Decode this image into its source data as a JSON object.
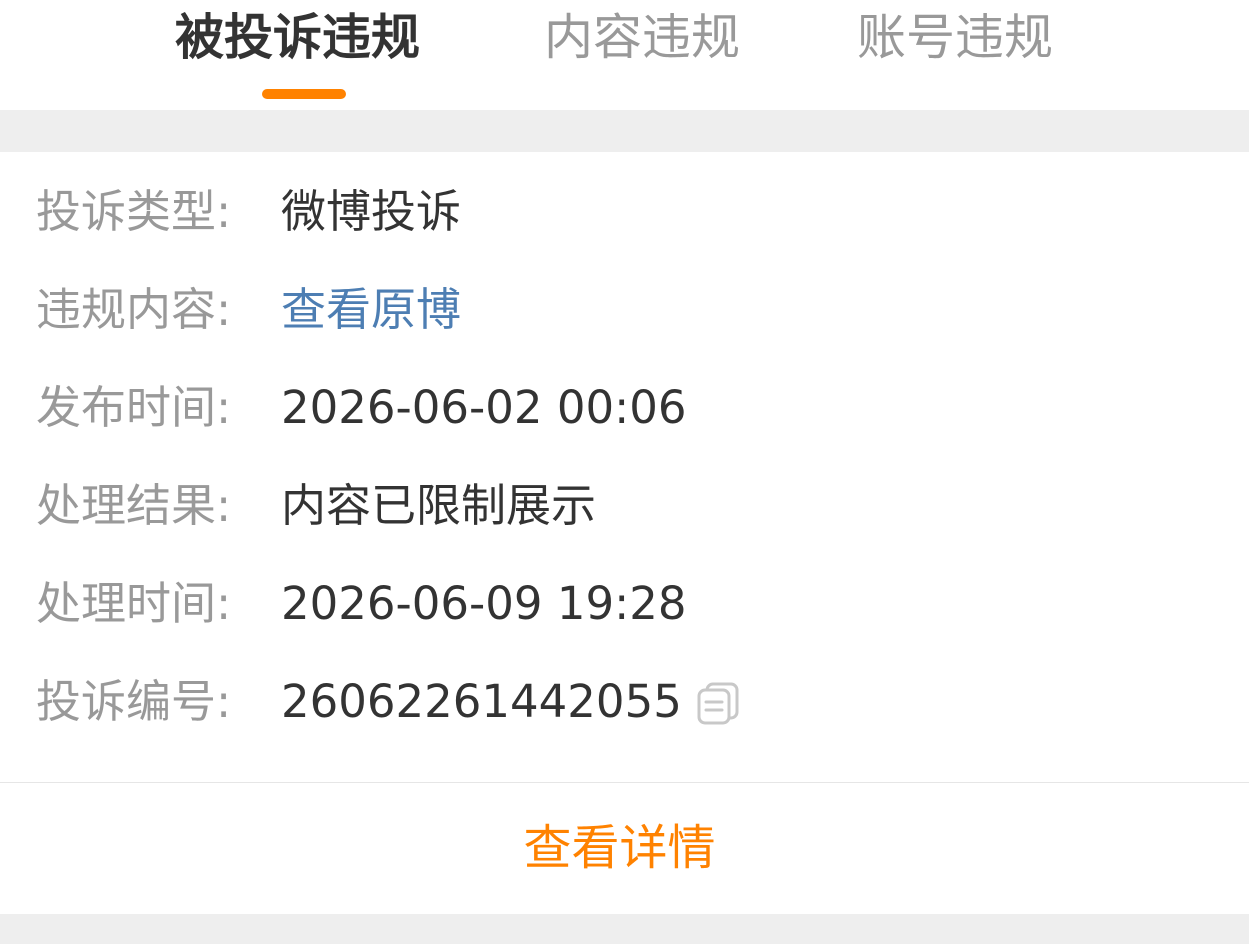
{
  "tabs": [
    {
      "label": "被投诉违规",
      "active": true
    },
    {
      "label": "内容违规",
      "active": false
    },
    {
      "label": "账号违规",
      "active": false
    }
  ],
  "colors": {
    "accent": "#ff8200",
    "link": "#4d7eb3",
    "label": "#999999",
    "value": "#333333",
    "band": "#eeeeee"
  },
  "details": [
    {
      "label": "投诉类型:",
      "value": "微博投诉"
    },
    {
      "label": "违规内容:",
      "value": "查看原博"
    },
    {
      "label": "发布时间:",
      "value": "2026-06-02 00:06"
    },
    {
      "label": "处理结果:",
      "value": "内容已限制展示"
    },
    {
      "label": "处理时间:",
      "value": "2026-06-09 19:28"
    },
    {
      "label": "投诉编号:",
      "value": "26062261442055",
      "icon": "copy-icon"
    }
  ],
  "actions": {
    "view_details_label": "查看详情"
  }
}
